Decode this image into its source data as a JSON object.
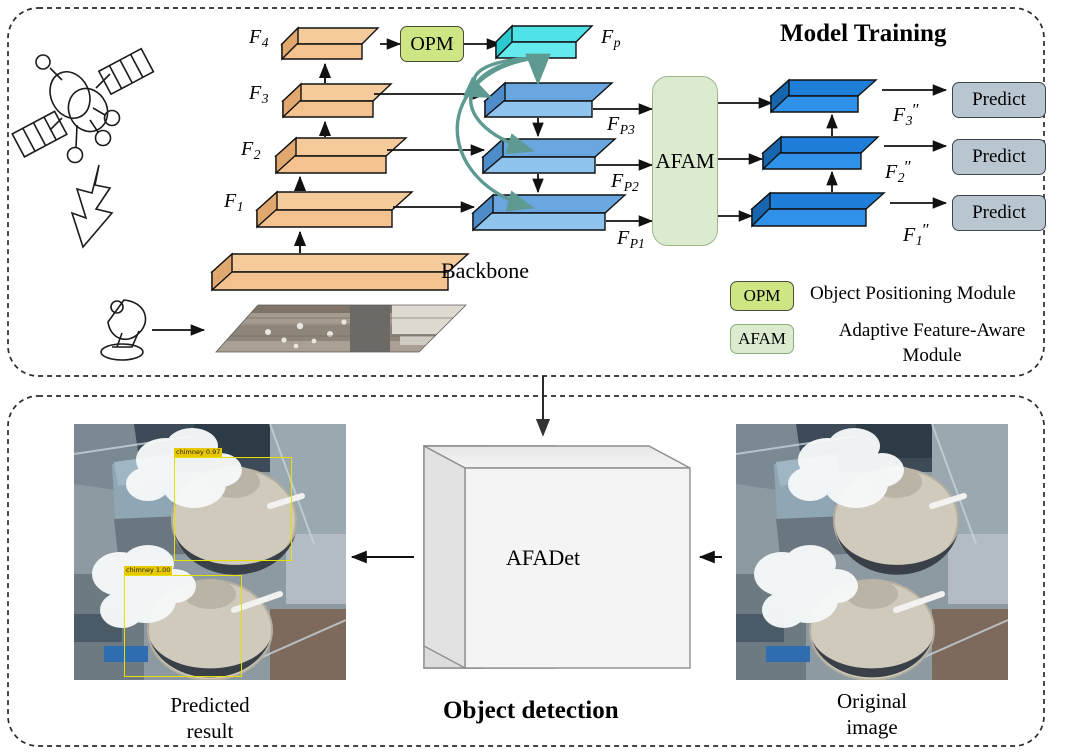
{
  "figure": {
    "domain": "diagram",
    "panels": [
      {
        "id": "model-training",
        "title": "Model Training"
      },
      {
        "id": "object-detection",
        "title": "Object detection"
      }
    ]
  },
  "top_panel": {
    "title": "Model Training",
    "backbone_label": "Backbone",
    "backbone_features": [
      {
        "key": "F1",
        "base": "F",
        "sub": "1"
      },
      {
        "key": "F2",
        "base": "F",
        "sub": "2"
      },
      {
        "key": "F3",
        "base": "F",
        "sub": "3"
      },
      {
        "key": "F4",
        "base": "F",
        "sub": "4"
      }
    ],
    "opm_block": {
      "label": "OPM"
    },
    "fp_label": {
      "base": "F",
      "sub": "p"
    },
    "pyramid_features": [
      {
        "key": "FP1",
        "base": "F",
        "sub": "P1"
      },
      {
        "key": "FP2",
        "base": "F",
        "sub": "P2"
      },
      {
        "key": "FP3",
        "base": "F",
        "sub": "P3"
      }
    ],
    "afam_block": {
      "label": "AFAM"
    },
    "output_features": [
      {
        "key": "F1dp",
        "base": "F",
        "sub": "1",
        "prime": "″"
      },
      {
        "key": "F2dp",
        "base": "F",
        "sub": "2",
        "prime": "″"
      },
      {
        "key": "F3dp",
        "base": "F",
        "sub": "3",
        "prime": "″"
      }
    ],
    "predict_boxes": [
      {
        "key": "predict-3",
        "label": "Predict"
      },
      {
        "key": "predict-2",
        "label": "Predict"
      },
      {
        "key": "predict-1",
        "label": "Predict"
      }
    ],
    "legend": [
      {
        "chip": "OPM",
        "text": "Object Positioning Module"
      },
      {
        "chip": "AFAM",
        "text": "Adaptive Feature-Aware Module"
      }
    ],
    "icons": {
      "satellite": "satellite-icon",
      "signal": "lightning-signal-icon",
      "ground_station": "ground-station-antenna-icon",
      "input_image": "aerial-input-image"
    }
  },
  "bottom_panel": {
    "title": "Object detection",
    "detector_block": {
      "label": "AFADet"
    },
    "left_image": {
      "caption_line1": "Predicted",
      "caption_line2": "result",
      "detections": [
        {
          "label": "chimney 0.97"
        },
        {
          "label": "chimney 1.00"
        }
      ]
    },
    "right_image": {
      "caption_line1": "Original",
      "caption_line2": "image"
    }
  },
  "colors": {
    "backbone_slab_top": "#f6cb9b",
    "backbone_slab_front": "#f3c28e",
    "backbone_slab_side": "#e0a86f",
    "pyramid_slab_top": "#6aa7e0",
    "pyramid_slab_front": "#8ec4ee",
    "fp_slab_top": "#4fe3e8",
    "fp_slab_front": "#63e9ee",
    "out_slab_top": "#1f7fd8",
    "out_slab_front": "#2f92e8",
    "opm_fill": "#cde583",
    "afam_fill": "#dcead0",
    "predict_fill": "#b9c5cf",
    "curve_arrow": "#5e9a92",
    "detector_fill": "#f2f2f2",
    "bbox_yellow": "#e8e000",
    "panel_border": "#2b2b2b"
  }
}
